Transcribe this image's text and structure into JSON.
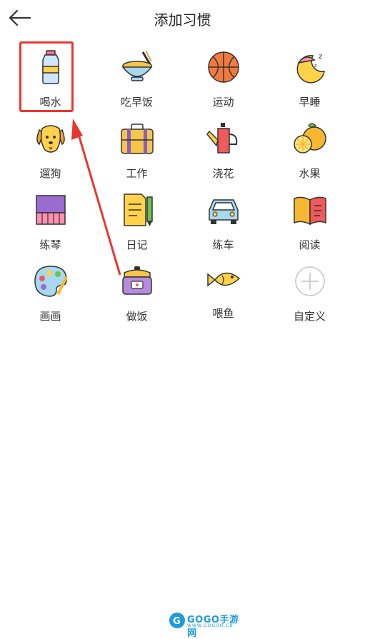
{
  "header": {
    "title": "添加习惯",
    "back_icon": "arrow-left-icon"
  },
  "habits": [
    {
      "label": "喝水",
      "icon": "water-bottle-icon"
    },
    {
      "label": "吃早饭",
      "icon": "noodle-bowl-icon"
    },
    {
      "label": "运动",
      "icon": "basketball-icon"
    },
    {
      "label": "早睡",
      "icon": "moon-sleep-icon"
    },
    {
      "label": "遛狗",
      "icon": "dog-icon"
    },
    {
      "label": "工作",
      "icon": "briefcase-icon"
    },
    {
      "label": "浇花",
      "icon": "watering-can-icon"
    },
    {
      "label": "水果",
      "icon": "orange-fruit-icon"
    },
    {
      "label": "练琴",
      "icon": "piano-icon"
    },
    {
      "label": "日记",
      "icon": "diary-pencil-icon"
    },
    {
      "label": "练车",
      "icon": "car-icon"
    },
    {
      "label": "阅读",
      "icon": "book-icon"
    },
    {
      "label": "画画",
      "icon": "paint-palette-icon"
    },
    {
      "label": "做饭",
      "icon": "rice-cooker-icon"
    },
    {
      "label": "喂鱼",
      "icon": "fish-icon"
    },
    {
      "label": "自定义",
      "icon": "plus-circle-icon"
    }
  ],
  "annotation": {
    "highlight_color": "#e8372f"
  },
  "watermark": {
    "text": "GOGO手游网",
    "sub": "WWW.GOGOH.CN"
  }
}
